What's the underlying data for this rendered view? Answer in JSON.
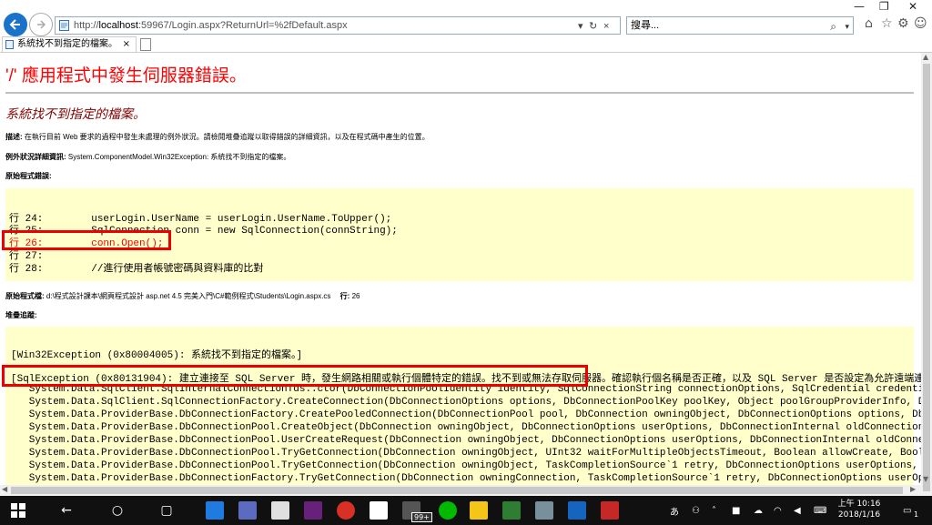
{
  "browser": {
    "url_prefix": "http://",
    "url_host": "localhost",
    "url_rest": ":59967/Login.aspx?ReturnUrl=%2fDefault.aspx",
    "search_placeholder": "搜尋...",
    "tab_title": "系統找不到指定的檔案。",
    "tab_close": "×"
  },
  "page": {
    "title": "'/' 應用程式中發生伺服器錯誤。",
    "subtitle": "系統找不到指定的檔案。",
    "desc_label": "描述:",
    "desc_text": " 在執行目前 Web 要求的過程中發生未處理的例外狀況。請檢閱堆疊追蹤以取得錯誤的詳細資訊，以及在程式碼中產生的位置。",
    "exc_label": "例外狀況詳細資訊:",
    "exc_text": " System.ComponentModel.Win32Exception: 系統找不到指定的檔案。",
    "src_error_label": "原始程式錯誤:",
    "src_lines": [
      "行 24:        userLogin.UserName = userLogin.UserName.ToUpper();",
      "行 25:        SqlConnection conn = new SqlConnection(connString);",
      "行 26:        conn.Open();",
      "行 27:",
      "行 28:        //進行使用者帳號密碼與資料庫的比對"
    ],
    "src_file_label": "原始程式檔:",
    "src_file_text": " d:\\程式設計課本\\網頁程式設計 asp.net 4.5 完美入門\\C#範例程式\\Students\\Login.aspx.cs",
    "src_line_label": "行:",
    "src_line_value": " 26",
    "stack_label": "堆疊追蹤:",
    "win32_line": "[Win32Exception (0x80004005): 系統找不到指定的檔案。]",
    "sql_line": "[SqlException (0x80131904): 建立連接至 SQL Server 時，發生網路相關或執行個體特定的錯誤。找不到或無法存取伺服器。確認執行個名稱是否正確，以及 SQL Server 是否設定為允許遠端連線。",
    "stack_lines": [
      "   System.Data.SqlClient.SqlInternalConnectionTds..ctor(DbConnectionPoolIdentity identity, SqlConnectionString connectionOptions, SqlCredential credential, Object pr",
      "   System.Data.SqlClient.SqlConnectionFactory.CreateConnection(DbConnectionOptions options, DbConnectionPoolKey poolKey, Object poolGroupProviderInfo, DbConnectionPo",
      "   System.Data.ProviderBase.DbConnectionFactory.CreatePooledConnection(DbConnectionPool pool, DbConnection owningObject, DbConnectionOptions options, DbConnectionPoo",
      "   System.Data.ProviderBase.DbConnectionPool.CreateObject(DbConnection owningObject, DbConnectionOptions userOptions, DbConnectionInternal oldConnection) +699",
      "   System.Data.ProviderBase.DbConnectionPool.UserCreateRequest(DbConnection owningObject, DbConnectionOptions userOptions, DbConnectionInternal oldConnection) +89",
      "   System.Data.ProviderBase.DbConnectionPool.TryGetConnection(DbConnection owningObject, UInt32 waitForMultipleObjectsTimeout, Boolean allowCreate, Boolean onlyOneCh",
      "   System.Data.ProviderBase.DbConnectionPool.TryGetConnection(DbConnection owningObject, TaskCompletionSource`1 retry, DbConnectionOptions userOptions, DbConnectionI",
      "   System.Data.ProviderBase.DbConnectionFactory.TryGetConnection(DbConnection owningConnection, TaskCompletionSource`1 retry, DbConnectionOptions userOptions, DbConn"
    ]
  },
  "taskbar": {
    "badge": "99+",
    "ime": "あ",
    "time": "上午 10:16",
    "date": "2018/1/16",
    "notif_count": "1"
  },
  "colors": {
    "title_red": "#ff0000",
    "subtitle_maroon": "#800000",
    "code_bg": "#ffffcc",
    "highlight_red": "#ee0000",
    "taskbar_bg": "#101010"
  }
}
